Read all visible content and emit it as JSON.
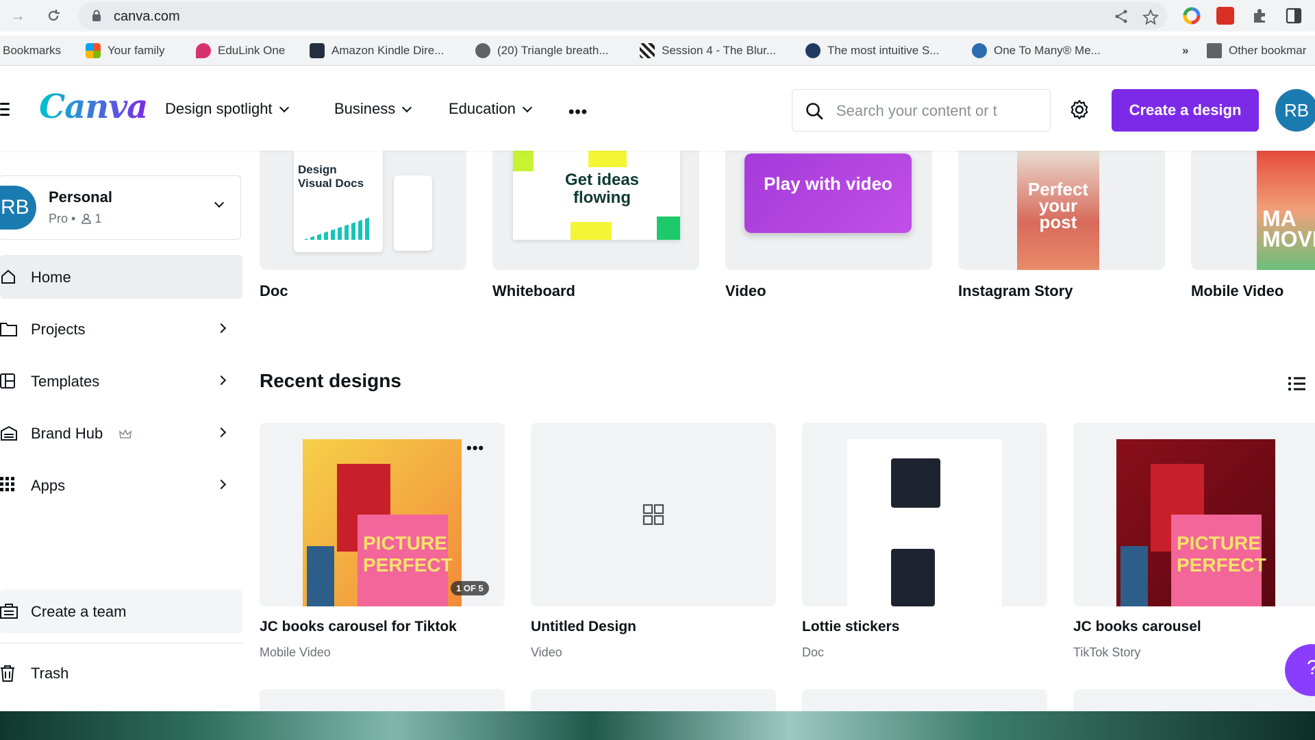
{
  "browser": {
    "url": "canva.com",
    "bookmarks": [
      {
        "label": "Bookmarks"
      },
      {
        "label": "Your family"
      },
      {
        "label": "EduLink One"
      },
      {
        "label": "Amazon Kindle Dire..."
      },
      {
        "label": "(20) Triangle breath..."
      },
      {
        "label": "Session 4 - The Blur..."
      },
      {
        "label": "The most intuitive S..."
      },
      {
        "label": "One To Many® Me..."
      },
      {
        "label": "»"
      },
      {
        "label": "Other bookmar"
      }
    ]
  },
  "header": {
    "logo": "Canva",
    "nav": [
      {
        "label": "Design spotlight"
      },
      {
        "label": "Business"
      },
      {
        "label": "Education"
      }
    ],
    "more": "•••",
    "search_placeholder": "Search your content or t",
    "create_label": "Create a design",
    "avatar_initials": "RB"
  },
  "sidebar": {
    "account": {
      "initials": "RB",
      "name": "Personal",
      "plan": "Pro •",
      "members": "1"
    },
    "items": [
      {
        "label": "Home",
        "active": true
      },
      {
        "label": "Projects"
      },
      {
        "label": "Templates"
      },
      {
        "label": "Brand Hub"
      },
      {
        "label": "Apps"
      }
    ],
    "create_team": "Create a team",
    "trash": "Trash"
  },
  "shortcuts": [
    {
      "label": "Doc",
      "thumb_text": "Design Visual Docs"
    },
    {
      "label": "Whiteboard",
      "thumb_text": "Get ideas flowing"
    },
    {
      "label": "Video",
      "thumb_text": "Play with video"
    },
    {
      "label": "Instagram Story",
      "thumb_text": "Perfect your post"
    },
    {
      "label": "Mobile Video",
      "thumb_text": "MA MOVE"
    }
  ],
  "recent": {
    "title": "Recent designs",
    "designs": [
      {
        "title": "JC books carousel for Tiktok",
        "type": "Mobile Video",
        "badge": "1 OF 5",
        "book": "PICTURE PERFECT"
      },
      {
        "title": "Untitled Design",
        "type": "Video"
      },
      {
        "title": "Lottie stickers",
        "type": "Doc"
      },
      {
        "title": "JC books carousel",
        "type": "TikTok Story",
        "book": "PICTURE PERFECT"
      }
    ]
  },
  "help": "?"
}
